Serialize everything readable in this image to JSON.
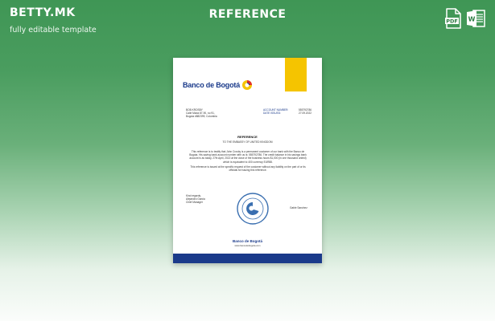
{
  "header": {
    "brand_logo": "BETTY.MK",
    "brand_tagline": "fully editable template",
    "title": "REFERENCE"
  },
  "file_formats": [
    "PDF",
    "W"
  ],
  "document": {
    "bank_name": "Banco de Bogotá",
    "address_lines": [
      "BOB KROSBY",
      "Calle Maria 87-90, no 91,",
      "Bogota #882399, Colombia"
    ],
    "account": [
      {
        "label": "ACCOUNT NUMBER:",
        "value": "555792786"
      },
      {
        "label": "DATE ISSUED:",
        "value": "27.09.2022"
      }
    ],
    "ref_title": "REFERENCE",
    "ref_subtitle": "TO THE EMBASSY OF UNITED KINGDOM",
    "paragraphs": [
      "This reference is to testify that John Crosby is a permanent customer of our bank with the Banco de Bogota. His saving bank account number with us is: 555792786. The credit balance in his savings bank account is as today, 27th April, 2022 at the close of the business hours $1,000 (in one thousand united) which is equivalent to 400 currency EUR88.",
      "This reference is issued at the specific request of the customer without any liability on the part of or its officials for issuing this reference."
    ],
    "regards": [
      "Kind regards,",
      "Alejandro Garcia",
      "Chief Manager"
    ],
    "signature_name": "Gable Sanchez",
    "stamp_text": "BANCO DE BOGOTA",
    "footer_bank": "Banco de Bogotá",
    "footer_small": "www.bancodebogota.com"
  },
  "colors": {
    "background_top": "#3f9655",
    "background_bottom": "#fbfdfb",
    "bank_blue": "#1a3a8a",
    "bank_yellow": "#f5c400",
    "bank_red": "#e0312c",
    "pdf_green": "#2e7d44"
  },
  "icons": [
    "pdf-file-icon",
    "word-file-icon",
    "bank-logo-icon",
    "bank-stamp-icon"
  ]
}
